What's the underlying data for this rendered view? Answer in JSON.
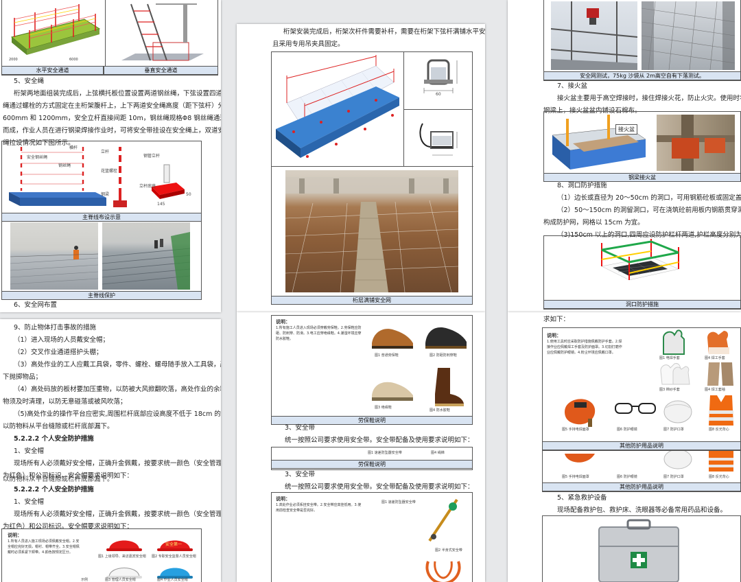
{
  "p1": {
    "fig1a": "水平安全通道",
    "fig1b": "垂直安全通道",
    "s5": "5、安全绳",
    "p5_1": "桁架两地面组装完成后，上弦横托板位置设置两道钢丝绳，下弦设置四道安全钢丝",
    "p5_2": "绳通过螺栓的方式固定在主桁架腹杆上，上下两道安全绳高度（距下弦杆）分别为",
    "p5_3": "600mm 和 1200mm，安全立杆直接间距 10m，钢丝绳规格Φ8 钢丝绳通过花篮螺栓连接",
    "p5_4": "而成，作业人员在进行钢梁焊接作业时，可将安全带挂设在安全绳上，双道安全钢丝",
    "p5_5": "绳拉设情况如下图所示。",
    "fig2": "主脊线布设示意",
    "fig3": "主脊线保护",
    "s6": "6、安全网布置",
    "labels": {
      "l1": "横杆",
      "l2": "安全钢丝绳",
      "l3": "钢丝绳",
      "l4": "立杆",
      "l5": "花篮螺栓",
      "l6": "钢梁",
      "l7": "立杆底座",
      "l8": "钢管立杆",
      "l9": "145",
      "l10": "50"
    }
  },
  "p2": {
    "l1": "桁架安装完成后，桁架次杆件需要补杆，需要在桁架下弦杆满铺水平安全网，并",
    "l2": "且采用专用吊夹具固定。",
    "dim": "60",
    "fig": "桁层满铺安全网"
  },
  "p3": {
    "fig1": "安全网测试，75kg 沙袋从 2m高空自有下落测试。",
    "s7": "7、接火盆",
    "p7_1": "接火盆主要用于高空焊接时，接住焊接火花，防止火灾。使用时将顶部扁钢挂在",
    "p7_2": "钢梁上，接火盆盆内铺设石棉布。",
    "tag": "接火盆",
    "fig2": "钢梁接火盆",
    "s8": "8、洞口防护措施",
    "p8_1": "（1）边长或直径为 20～50cm 的洞口，可用钢筋砼板或固定盖板防护。",
    "p8_2": "（2）50～150cm 的洞留洞口，可在浇筑砼前用板内钢筋贯穿洞径，不剪断网筋，",
    "p8_3": "构成防护网，网格以 15cm 为宜。",
    "p8_4": "（3)150cm 以上的洞口,四周应设防护栏杆两道,护栏高度分别为 40cm 和 100cm，",
    "fig3": "洞口防护措施"
  },
  "p4": {
    "s9": "9、防止物体打击事故的措施",
    "i1": "（1）进入现场的人员戴安全帽；",
    "i2": "（2）交叉作业通道搭护头棚；",
    "i3": "（3）高处作业的工人应戴工具袋，零件、螺栓、螺母随手放入工具袋，严禁向",
    "i3b": "下抛掷物品；",
    "i4": "（4）高处码放的板材要加压重物，以防被大风掀翻吹落，高处作业的余料、废",
    "i4b": "物须及时清理，以防无意碰落或被风吹落；",
    "i5": "（5)高处作业的操作平台应密实,周围栏杆底部应设高度不低于 18cm 的挡脚板，",
    "i5b": "以防物料从平台缝隙或栏杆底部漏下。",
    "h1": "5.2.2.2 个人安全防护措施",
    "helmet": "1、安全帽",
    "hp1": "现场所有人必须戴好安全帽，正确升金佩戴，按要求统一颜色（安全管理人员",
    "hp2": "为红色）和公司标识。安全帽要求说明如下：",
    "ov": "以防物料从平台缝隙或栏杆底部漏下。",
    "h2": "5.2.2.2 个人安全防护措施",
    "helmet2": "1、安全帽",
    "hp3": "现场所有人必须戴好安全帽，正确升金佩戴，按要求统一颜色（安全管理人员",
    "hp4": "为红色）和公司标识。安全帽要求说明如下：",
    "note_title": "说明：",
    "note": "1.所有人员进入施工现场必须佩戴安全帽。2.安全帽应完好无损，帽衬、帽带齐全。3.安全帽佩戴时必须系紧下颏带。4.颜色按规定区分。",
    "c1": "图1  上级领导、来访嘉宾安全帽",
    "c2": "图2  专职安全监督人员安全帽",
    "c3": "图3  管理人员安全帽",
    "c4": "图4  作业人员安全帽",
    "hlogo": "安全第一",
    "tail": "示例"
  },
  "p5": {
    "note_title": "说明：",
    "note": "1.所有施工人员进入现场必须穿戴劳保鞋。2.劳保鞋应防砸、防刺穿、防滑。3.电工应穿绝缘鞋。4.潮湿环境应穿防水胶鞋。",
    "s1": "图1  普通劳保鞋",
    "s2": "图2  防砸防刺穿鞋",
    "s3": "图3  绝缘鞋",
    "s4": "图4  防水胶鞋",
    "fig1": "劳保鞋说明",
    "belt": "3、安全带",
    "bp": "统一按照公司要求使用安全带。安全带配备及使用要求说明如下：",
    "strip1": "图1  速差防坠器安全带",
    "strip2": "图4  绳梯",
    "fig2": "劳保鞋说明",
    "belt2": "3、安全带",
    "bp2": "统一按照公司要求使用安全带。安全带配备及使用要求说明如下：",
    "note2_title": "说明：",
    "note2": "1.高处作业必须系挂安全带。2.安全带应高挂低用。3.使用前检查安全带是否完好。",
    "b1": "图1  速差防坠器安全带",
    "b2": "图2  半身式安全带"
  },
  "p6": {
    "req": "求如下：",
    "note_title": "说明：",
    "note": "1.使用工具时应采取防护措施佩戴防护手套。2.焊接作业应佩戴焊工手套及防护面罩。3.切割打磨作业应佩戴防护眼镜。4.粉尘环境应佩戴口罩。",
    "g1": "图1  电焊手套",
    "g2": "图4  焊工手套",
    "g3": "图3  棉纱手套",
    "g4": "图4  焊工套袖",
    "g5": "图5  手持电焊面罩",
    "g6": "图6  防护眼镜",
    "g7": "图7  防护口罩",
    "g8": "图8  反光背心",
    "fig1": "其他防护用品说明",
    "g9": "图5  手持电焊面罩",
    "g10": "图6  防护眼镜",
    "g11": "图7  防护口罩",
    "g12": "图8  反光背心",
    "fig2": "其他防护用品说明",
    "s5": "5、紧急救护设备",
    "p5": "现场配备救护包、救护床、洗眼器等必备常用药品和设备。"
  }
}
